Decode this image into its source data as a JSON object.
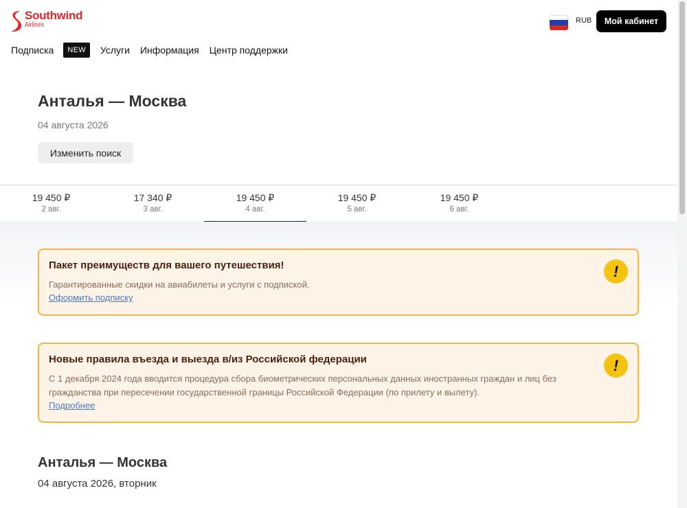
{
  "brand": {
    "name": "Southwind",
    "sub": "Airlines",
    "color": "#e0262b"
  },
  "header": {
    "currency": "RUB",
    "cabinet_label": "Мой кабинет",
    "flag": {
      "colors": [
        "#ffffff",
        "#1c3fb5",
        "#d52b1e"
      ]
    }
  },
  "nav": {
    "subscription": "Подписка",
    "badge": "NEW",
    "services": "Услуги",
    "info": "Информация",
    "support": "Центр поддержки"
  },
  "search": {
    "route": "Анталья — Москва",
    "date": "04 августа 2026",
    "change_label": "Изменить поиск"
  },
  "date_tabs": [
    {
      "price": "19 450 ₽",
      "date": "2 авг."
    },
    {
      "price": "17 340 ₽",
      "date": "3 авг."
    },
    {
      "price": "19 450 ₽",
      "date": "4 авг."
    },
    {
      "price": "19 450 ₽",
      "date": "5 авг."
    },
    {
      "price": "19 450 ₽",
      "date": "6 авг."
    }
  ],
  "alerts": [
    {
      "title": "Пакет преимуществ для вашего путешествия!",
      "text": "Гарантированные скидки на авиабилеты и услуги с подпиской.",
      "link": "Оформить подписку",
      "icon": "exclamation-icon"
    },
    {
      "title": "Новые правила въезда и выезда в/из Российской федерации",
      "text": "С 1 декабря 2024 года вводится процедура сбора биометрических персональных данных иностранных граждан и лиц без гражданства при пересечении государственной границы Российской Федерации (по прилету и вылету).",
      "link": "Подробнее",
      "icon": "exclamation-icon"
    }
  ],
  "results": {
    "route": "Анталья — Москва",
    "date": "04 августа 2026, вторник"
  }
}
